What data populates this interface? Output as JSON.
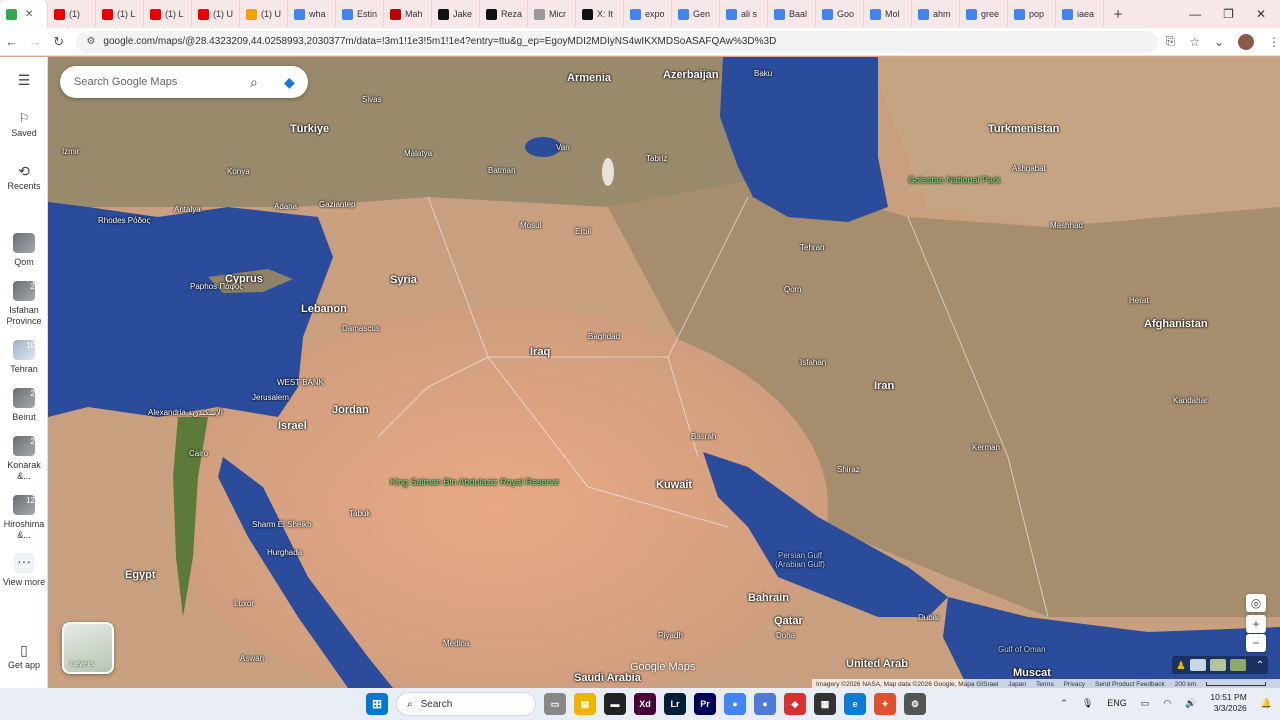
{
  "browser": {
    "tabs": [
      {
        "label": "",
        "color": "#34a853",
        "active": true
      },
      {
        "label": "(1)",
        "color": "#e00"
      },
      {
        "label": "(1) L",
        "color": "#e00"
      },
      {
        "label": "(1) L",
        "color": "#e00"
      },
      {
        "label": "(1) U",
        "color": "#e00"
      },
      {
        "label": "(1) U",
        "color": "#f7a000"
      },
      {
        "label": "wha",
        "color": "#4285f4"
      },
      {
        "label": "Estin",
        "color": "#4285f4"
      },
      {
        "label": "Mah",
        "color": "#b00"
      },
      {
        "label": "Jake",
        "color": "#111"
      },
      {
        "label": "Reza",
        "color": "#111"
      },
      {
        "label": "Micr",
        "color": "#999"
      },
      {
        "label": "X: It",
        "color": "#111"
      },
      {
        "label": "expo",
        "color": "#4285f4"
      },
      {
        "label": "Gen",
        "color": "#4285f4"
      },
      {
        "label": "ali s",
        "color": "#4285f4"
      },
      {
        "label": "Baal",
        "color": "#4285f4"
      },
      {
        "label": "Goo",
        "color": "#4285f4"
      },
      {
        "label": "Mol",
        "color": "#4285f4"
      },
      {
        "label": "ahm",
        "color": "#4285f4"
      },
      {
        "label": "gree",
        "color": "#4285f4"
      },
      {
        "label": "pop",
        "color": "#4285f4"
      },
      {
        "label": "iaea",
        "color": "#4285f4"
      }
    ],
    "new_tab": "+",
    "window_controls": [
      "—",
      "❐",
      "✕"
    ],
    "url": "google.com/maps/@28.4323209,44.0258993,2030377m/data=!3m1!1e3!5m1!1e4?entry=ttu&g_ep=EgoyMDI2MDIyNS4wIKXMDSoASAFQAw%3D%3D"
  },
  "sidebar": {
    "menu_icon": "☰",
    "items": [
      {
        "label": "Saved",
        "icon": "bookmark-icon",
        "glyph": "🔖"
      },
      {
        "label": "Recents",
        "icon": "history-icon",
        "glyph": "⟲"
      },
      {
        "label": "Qom",
        "badge": ""
      },
      {
        "label": "Isfahan Province",
        "badge": "2"
      },
      {
        "label": "Tehran",
        "badge": "10"
      },
      {
        "label": "Beirut",
        "badge": "2"
      },
      {
        "label": "Konarak &...",
        "badge": "2"
      },
      {
        "label": "Hiroshima &...",
        "badge": "12"
      },
      {
        "label": "View more",
        "glyph": "···"
      },
      {
        "label": "Get app",
        "glyph": "▯"
      }
    ]
  },
  "search": {
    "placeholder": "Search Google Maps"
  },
  "map_labels": {
    "countries": [
      "Armenia",
      "Azerbaijan",
      "Türkiye",
      "Turkmenistan",
      "Syria",
      "Lebanon",
      "Iraq",
      "Iran",
      "Afghanistan",
      "Jordan",
      "Israel",
      "Egypt",
      "Kuwait",
      "Bahrain",
      "Qatar",
      "Saudi Arabia",
      "Cyprus",
      "WEST BANK",
      "United Arab",
      "Muscat"
    ],
    "cities": [
      "Baku",
      "Tabriz",
      "Tehran",
      "Ashgabat",
      "Mashhad",
      "Ankara",
      "Konya",
      "Antalya",
      "Adana",
      "Gaziantep",
      "Izmir",
      "Rhodes Ρόδος",
      "Paphos Πάφος",
      "Damascus",
      "Baghdad",
      "Erbil",
      "Mosul",
      "Jerusalem",
      "Alexandria الإسكندرية",
      "Cairo",
      "Basrah",
      "Shiraz",
      "Isfahan",
      "Kerman",
      "Dubai",
      "Doha",
      "Riyadh",
      "Medina",
      "Luxor",
      "Hurghada",
      "Sharm El Sheikh",
      "Tabuk",
      "Herat",
      "Kandahar",
      "Qom",
      "Aswan",
      "Sivas",
      "Malatya",
      "Batman",
      "Van"
    ],
    "parks": [
      "Golestan National Park",
      "King Salman Bin Abdulaziz Royal Reserve"
    ],
    "water": [
      "Persian Gulf (Arabian Gulf)",
      "Gulf of Oman"
    ]
  },
  "layers_label": "Layers",
  "google_maps_logo": "Google Maps",
  "attribution": {
    "imagery": "Imagery ©2026 NASA, Map data ©2026 Google, Mapa GISrael",
    "links": [
      "Japan",
      "Terms",
      "Privacy",
      "Send Product Feedback"
    ],
    "scale": "200 km"
  },
  "taskbar": {
    "search_label": "Search",
    "apps": [
      {
        "name": "file-explorer",
        "color": "#f0b400",
        "glyph": "▤"
      },
      {
        "name": "terminal",
        "color": "#222",
        "glyph": "▬"
      },
      {
        "name": "xd",
        "color": "#470137",
        "glyph": "Xd"
      },
      {
        "name": "lightroom",
        "color": "#001e36",
        "glyph": "Lr"
      },
      {
        "name": "premiere",
        "color": "#00005b",
        "glyph": "Pr"
      },
      {
        "name": "chrome",
        "color": "#4285f4",
        "glyph": "●"
      },
      {
        "name": "chrome-alt",
        "color": "#4f7bd6",
        "glyph": "●"
      },
      {
        "name": "app-red",
        "color": "#d7322f",
        "glyph": "◆"
      },
      {
        "name": "app-store",
        "color": "#333",
        "glyph": "▦"
      },
      {
        "name": "edge",
        "color": "#0c7cd5",
        "glyph": "e"
      },
      {
        "name": "app-orange",
        "color": "#e2502e",
        "glyph": "✦"
      },
      {
        "name": "settings",
        "color": "#555",
        "glyph": "⚙"
      }
    ],
    "lang": "ENG",
    "time": "10:51 PM",
    "date": "3/3/2026"
  },
  "colors": {
    "sea": "#2a4c9a",
    "land": "#cf9e7e",
    "mountain": "#8e7a62",
    "desert": "#e0a27c"
  }
}
